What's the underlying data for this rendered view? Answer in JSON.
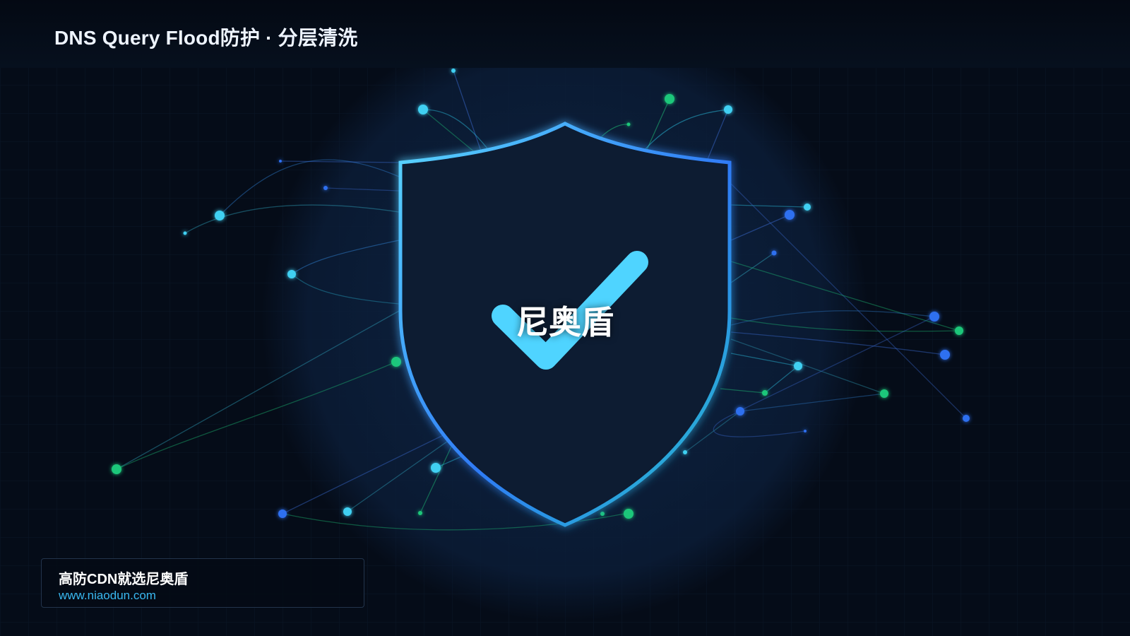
{
  "header": {
    "title": "DNS Query Flood防护 · 分层清洗"
  },
  "shield": {
    "label": "尼奥盾",
    "check_icon": "checkmark-icon"
  },
  "footer": {
    "slogan": "高防CDN就选尼奥盾",
    "url": "www.niaodun.com"
  },
  "colors": {
    "background": "#050c18",
    "shield_fill": "#0b1a33",
    "shield_border_start": "#4fd4ff",
    "shield_border_end": "#2f6ef0",
    "checkmark": "#4fd4ff",
    "node_cyan": "#3fd0f2",
    "node_blue": "#2d6ff0",
    "node_green": "#1fc77a",
    "url": "#39b8f0"
  }
}
